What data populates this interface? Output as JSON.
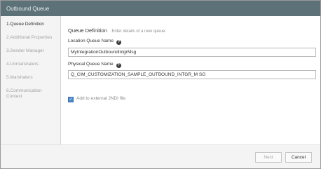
{
  "window": {
    "title": "Outbound Queue"
  },
  "sidebar": {
    "steps": [
      {
        "label": "1.Queue Definition"
      },
      {
        "label": "2.Additional Properties"
      },
      {
        "label": "3.Sender Manager"
      },
      {
        "label": "4.Unmarshalers"
      },
      {
        "label": "5.Marshalers"
      },
      {
        "label": "6.Communication Context"
      }
    ]
  },
  "main": {
    "title": "Queue Definition",
    "subtitle": "Enter details of a new queue.",
    "location_label": "Location Queue Name",
    "location_value": "MyIntegrationOutboundIntgrMsg",
    "physical_label": "Physical Queue Name",
    "physical_value": "Q_CIM_CUSTOMIZATION_SAMPLE_OUTBOUND_INTGR_M SG",
    "jndi_label": "Add to external JNDI file",
    "jndi_checked": true,
    "help_glyph": "?"
  },
  "footer": {
    "next_label": "Next",
    "cancel_label": "Cancel"
  }
}
